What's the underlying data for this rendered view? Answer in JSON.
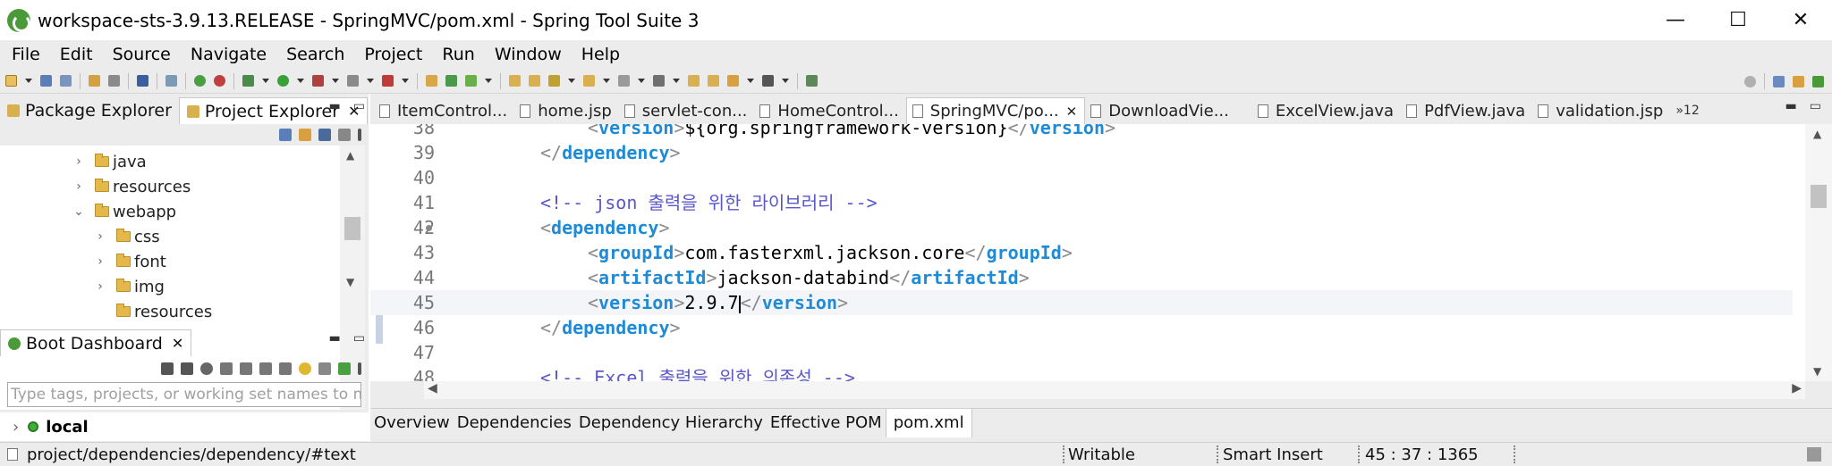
{
  "window": {
    "title": "workspace-sts-3.9.13.RELEASE - SpringMVC/pom.xml - Spring Tool Suite 3",
    "minimize": "—",
    "maximize": "☐",
    "close": "✕"
  },
  "menu": [
    "File",
    "Edit",
    "Source",
    "Navigate",
    "Search",
    "Project",
    "Run",
    "Window",
    "Help"
  ],
  "left_panel": {
    "tabs": [
      {
        "label": "Package Explorer",
        "active": false
      },
      {
        "label": "Project Explorer",
        "active": true
      }
    ],
    "close": "✕",
    "minimize": "▬",
    "maximize": "▭",
    "tree": [
      {
        "label": "java",
        "chevron": "›",
        "indent": 1
      },
      {
        "label": "resources",
        "chevron": "›",
        "indent": 1
      },
      {
        "label": "webapp",
        "chevron": "⌄",
        "indent": 1
      },
      {
        "label": "css",
        "chevron": "›",
        "indent": 2
      },
      {
        "label": "font",
        "chevron": "›",
        "indent": 2
      },
      {
        "label": "img",
        "chevron": "›",
        "indent": 2
      },
      {
        "label": "resources",
        "chevron": "",
        "indent": 2
      }
    ]
  },
  "boot_dashboard": {
    "tab_label": "Boot Dashboard",
    "close": "✕",
    "filter_placeholder": "Type tags, projects, or working set names to ma",
    "local_label": "local",
    "local_chevron": "›"
  },
  "editor": {
    "tabs": [
      {
        "label": "ItemControl...",
        "active": false,
        "closable": false
      },
      {
        "label": "home.jsp",
        "active": false,
        "closable": false
      },
      {
        "label": "servlet-con...",
        "active": false,
        "closable": false
      },
      {
        "label": "HomeControl...",
        "active": false,
        "closable": false
      },
      {
        "label": "SpringMVC/po...",
        "active": true,
        "closable": true
      },
      {
        "label": "DownloadVie...",
        "active": false,
        "closable": false
      },
      {
        "label": "ExcelView.java",
        "active": false,
        "closable": false
      },
      {
        "label": "PdfView.java",
        "active": false,
        "closable": false
      },
      {
        "label": "validation.jsp",
        "active": false,
        "closable": false
      }
    ],
    "tab_overflow": "»12",
    "close": "✕",
    "lines": [
      {
        "num": "38",
        "indent": 4,
        "parts": [
          [
            "br",
            "<"
          ],
          [
            "tag",
            "version"
          ],
          [
            "br",
            ">"
          ],
          [
            "txt",
            "${org.springframework-version}"
          ],
          [
            "br",
            "</"
          ],
          [
            "tag",
            "version"
          ],
          [
            "br",
            ">"
          ]
        ]
      },
      {
        "num": "39",
        "indent": 2,
        "parts": [
          [
            "br",
            "</"
          ],
          [
            "tag",
            "dependency"
          ],
          [
            "br",
            ">"
          ]
        ]
      },
      {
        "num": "40",
        "indent": 0,
        "parts": []
      },
      {
        "num": "41",
        "indent": 2,
        "parts": [
          [
            "cmt",
            "<!-- "
          ],
          [
            "cmt",
            "json"
          ],
          [
            "cmt",
            " 출력을 위한 라이브러리 -->"
          ]
        ]
      },
      {
        "num": "42",
        "indent": 2,
        "dot": true,
        "parts": [
          [
            "br",
            "<"
          ],
          [
            "tag",
            "dependency"
          ],
          [
            "br",
            ">"
          ]
        ]
      },
      {
        "num": "43",
        "indent": 4,
        "parts": [
          [
            "br",
            "<"
          ],
          [
            "tag",
            "groupId"
          ],
          [
            "br",
            ">"
          ],
          [
            "txt",
            "com.fasterxml.jackson.core"
          ],
          [
            "br",
            "</"
          ],
          [
            "tag",
            "groupId"
          ],
          [
            "br",
            ">"
          ]
        ]
      },
      {
        "num": "44",
        "indent": 4,
        "parts": [
          [
            "br",
            "<"
          ],
          [
            "tag",
            "artifactId"
          ],
          [
            "br",
            ">"
          ],
          [
            "txt",
            "jackson-databind"
          ],
          [
            "br",
            "</"
          ],
          [
            "tag",
            "artifactId"
          ],
          [
            "br",
            ">"
          ]
        ]
      },
      {
        "num": "45",
        "indent": 4,
        "current": true,
        "parts": [
          [
            "br",
            "<"
          ],
          [
            "tag",
            "version"
          ],
          [
            "br",
            ">"
          ],
          [
            "txt",
            "2.9.7"
          ],
          [
            "cursor",
            ""
          ],
          [
            "br",
            "</"
          ],
          [
            "tag",
            "version"
          ],
          [
            "br",
            ">"
          ]
        ]
      },
      {
        "num": "46",
        "indent": 2,
        "parts": [
          [
            "br",
            "</"
          ],
          [
            "tag",
            "dependency"
          ],
          [
            "br",
            ">"
          ]
        ]
      },
      {
        "num": "47",
        "indent": 0,
        "parts": []
      },
      {
        "num": "48",
        "indent": 2,
        "parts": [
          [
            "cmt",
            "<!-- Excel 출력을 위한 의존성 -->"
          ]
        ]
      }
    ],
    "bottom_tabs": [
      {
        "label": "Overview",
        "active": false
      },
      {
        "label": "Dependencies",
        "active": false
      },
      {
        "label": "Dependency Hierarchy",
        "active": false
      },
      {
        "label": "Effective POM",
        "active": false
      },
      {
        "label": "pom.xml",
        "active": true
      }
    ]
  },
  "status": {
    "path": "project/dependencies/dependency/#text",
    "writable": "Writable",
    "insert_mode": "Smart Insert",
    "position": "45 : 37 : 1365"
  },
  "colors": {
    "tag": "#1f8bd6",
    "comment": "#5a57c9",
    "bracket": "#8a8a8a",
    "spring_green": "#4b9a3a"
  }
}
